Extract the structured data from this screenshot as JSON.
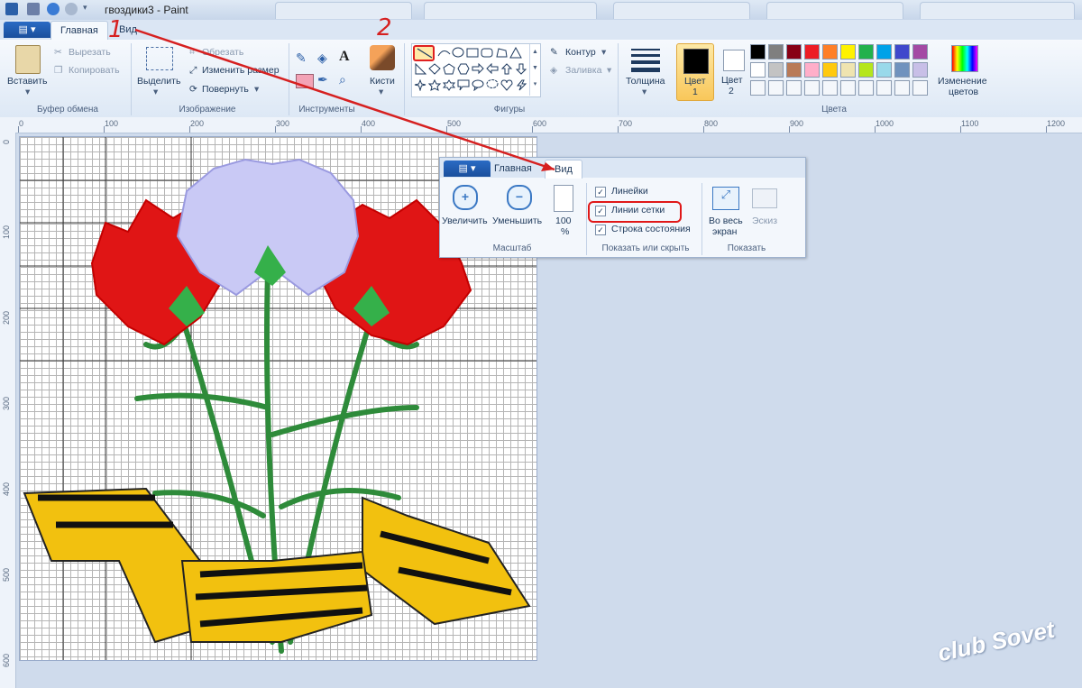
{
  "window": {
    "title": "гвоздики3 - Paint"
  },
  "tabs": {
    "file_label": "",
    "home": "Главная",
    "view": "Вид"
  },
  "clipboard": {
    "paste": "Вставить",
    "cut": "Вырезать",
    "copy": "Копировать",
    "group": "Буфер обмена"
  },
  "image": {
    "select": "Выделить",
    "crop": "Обрезать",
    "resize": "Изменить размер",
    "rotate": "Повернуть",
    "group": "Изображение"
  },
  "tools": {
    "group": "Инструменты"
  },
  "brushes": {
    "label": "Кисти"
  },
  "shapes": {
    "outline": "Контур",
    "fill": "Заливка",
    "group": "Фигуры"
  },
  "thickness": {
    "label": "Толщина"
  },
  "colors": {
    "color1": "Цвет",
    "color1_num": "1",
    "color2": "Цвет",
    "color2_num": "2",
    "edit": "Изменение",
    "edit2": "цветов",
    "group": "Цвета",
    "row1": [
      "#000000",
      "#7f7f7f",
      "#880015",
      "#ed1c24",
      "#ff7f27",
      "#fff200",
      "#22b14c",
      "#00a2e8",
      "#3f48cc",
      "#a349a4"
    ],
    "row2": [
      "#ffffff",
      "#c3c3c3",
      "#b97a57",
      "#ffaec9",
      "#ffc90e",
      "#efe4b0",
      "#b5e61d",
      "#99d9ea",
      "#7092be",
      "#c8bfe7"
    ]
  },
  "ruler": {
    "h": [
      "0",
      "100",
      "200",
      "300",
      "400",
      "500",
      "600",
      "700",
      "800",
      "900",
      "1000",
      "1100",
      "1200"
    ],
    "v": [
      "0",
      "100",
      "200",
      "300",
      "400",
      "500",
      "600"
    ]
  },
  "popup": {
    "home_tab": "Главная",
    "view_tab": "Вид",
    "zoom_in": "Увеличить",
    "zoom_out": "Уменьшить",
    "zoom_100": "100",
    "zoom_pct": "%",
    "zoom_group": "Масштаб",
    "rulers": "Линейки",
    "gridlines": "Линии сетки",
    "statusbar": "Строка состояния",
    "showhide_group": "Показать или скрыть",
    "fullscreen": "Во весь",
    "fullscreen2": "экран",
    "thumbnail": "Эскиз",
    "show_group": "Показать"
  },
  "annotations": {
    "step1": "1",
    "step2": "2"
  },
  "watermark": {
    "text": "club Sovet"
  }
}
